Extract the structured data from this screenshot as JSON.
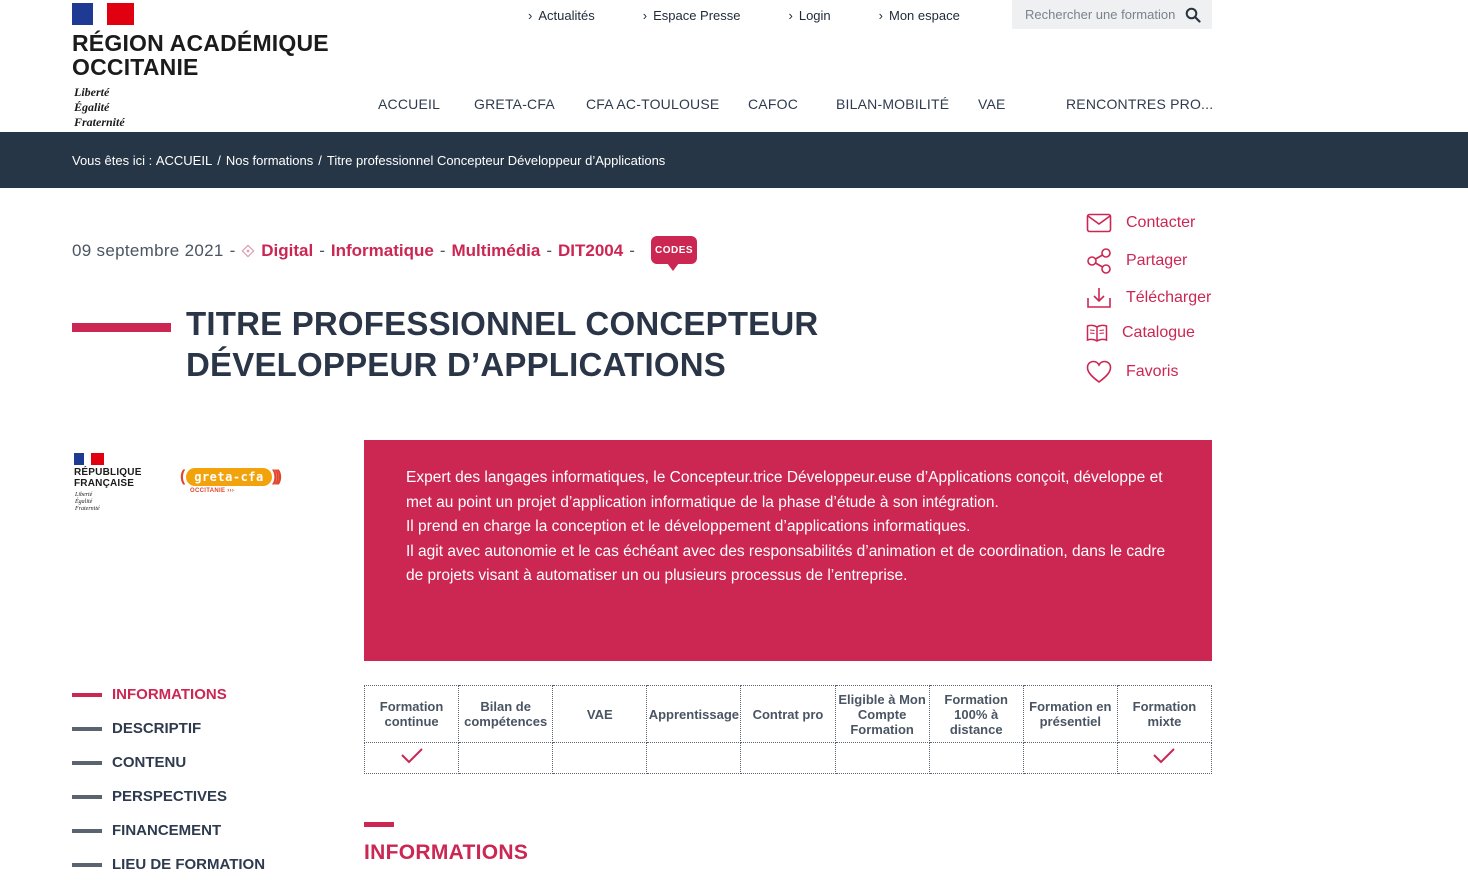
{
  "header": {
    "logo_title_line1": "RÉGION ACADÉMIQUE",
    "logo_title_line2": "OCCITANIE",
    "motto_1": "Liberté",
    "motto_2": "Égalité",
    "motto_3": "Fraternité",
    "top_links": [
      "Actualités",
      "Espace Presse",
      "Login",
      "Mon espace"
    ],
    "search_placeholder": "Rechercher une formation",
    "nav": [
      "ACCUEIL",
      "GRETA-CFA",
      "CFA AC-TOULOUSE",
      "CAFOC",
      "BILAN-MOBILITÉ",
      "VAE",
      "RENCONTRES PRO..."
    ]
  },
  "breadcrumb": {
    "prefix": "Vous êtes ici :",
    "items": [
      "ACCUEIL",
      "Nos formations",
      "Titre professionnel Concepteur Développeur d’Applications"
    ]
  },
  "meta": {
    "date": "09 septembre 2021",
    "categories": [
      "Digital",
      "Informatique",
      "Multimédia",
      "DIT2004"
    ],
    "codes_label": "CODES"
  },
  "title": {
    "line1": "TITRE PROFESSIONNEL CONCEPTEUR",
    "line2": "DÉVELOPPEUR D’APPLICATIONS"
  },
  "actions": [
    "Contacter",
    "Partager",
    "Télécharger",
    "Catalogue",
    "Favoris"
  ],
  "logos": {
    "rf_line1": "RÉPUBLIQUE",
    "rf_line2": "FRANÇAISE",
    "rf_motto": "Liberté Égalité Fraternité",
    "greta_name": "GRETA-CFA",
    "greta_sub": "OCCITANIE"
  },
  "description": [
    "Expert des langages informatiques, le Concepteur.trice Développeur.euse d’Applications conçoit, développe et met au point un projet d’application informatique de la phase d’étude à son intégration.",
    "Il prend en charge la conception et le développement d’applications informatiques.",
    "Il agit avec autonomie et le cas échéant avec des responsabilités d’animation et de coordination, dans le cadre de projets visant à automatiser un ou plusieurs processus de l’entreprise."
  ],
  "side_nav": [
    "INFORMATIONS",
    "DESCRIPTIF",
    "CONTENU",
    "PERSPECTIVES",
    "FINANCEMENT",
    "LIEU DE FORMATION"
  ],
  "modes": {
    "headers": [
      "Formation continue",
      "Bilan de compétences",
      "VAE",
      "Apprentissage",
      "Contrat pro",
      "Eligible à Mon Compte Formation",
      "Formation 100% à distance",
      "Formation en présentiel",
      "Formation mixte"
    ],
    "checked": [
      true,
      false,
      false,
      false,
      false,
      false,
      false,
      false,
      true
    ]
  },
  "section_title": "INFORMATIONS",
  "colors": {
    "accent": "#cc2753",
    "dark_bar": "#263646",
    "text": "#2a3648"
  }
}
